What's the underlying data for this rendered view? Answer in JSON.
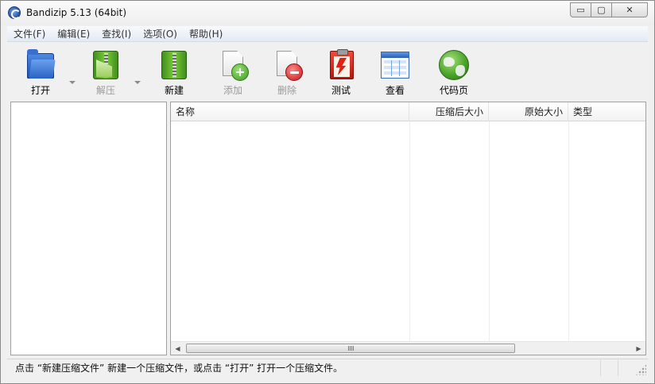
{
  "window": {
    "title": "Bandizip 5.13 (64bit)",
    "min_glyph": "▭",
    "max_glyph": "▢",
    "close_glyph": "✕"
  },
  "menu": [
    {
      "label": "文件(F)"
    },
    {
      "label": "编辑(E)"
    },
    {
      "label": "查找(I)"
    },
    {
      "label": "选项(O)"
    },
    {
      "label": "帮助(H)"
    }
  ],
  "toolbar": {
    "open": {
      "label": "打开",
      "icon": "folder-icon",
      "enabled": true
    },
    "extract": {
      "label": "解压",
      "icon": "extract-archive-icon",
      "enabled": false
    },
    "new": {
      "label": "新建",
      "icon": "zip-archive-icon",
      "enabled": true
    },
    "add": {
      "label": "添加",
      "icon": "add-file-icon",
      "enabled": false
    },
    "delete": {
      "label": "删除",
      "icon": "delete-file-icon",
      "enabled": false
    },
    "test": {
      "label": "测试",
      "icon": "clipboard-test-icon",
      "enabled": true
    },
    "view": {
      "label": "查看",
      "icon": "view-window-icon",
      "enabled": true
    },
    "codepage": {
      "label": "代码页",
      "icon": "globe-icon",
      "enabled": true
    }
  },
  "file_list": {
    "columns": [
      {
        "label": "名称"
      },
      {
        "label": "压缩后大小"
      },
      {
        "label": "原始大小"
      },
      {
        "label": "类型"
      }
    ],
    "rows": []
  },
  "scrollbar": {
    "left_arrow": "◀",
    "right_arrow": "▶"
  },
  "status": {
    "text": "点击 “新建压缩文件” 新建一个压缩文件，或点击 “打开” 打开一个压缩文件。"
  },
  "colors": {
    "window_bg": "#f0f0f0",
    "pane_bg": "#ffffff",
    "disabled_text": "#9a9a9a"
  }
}
